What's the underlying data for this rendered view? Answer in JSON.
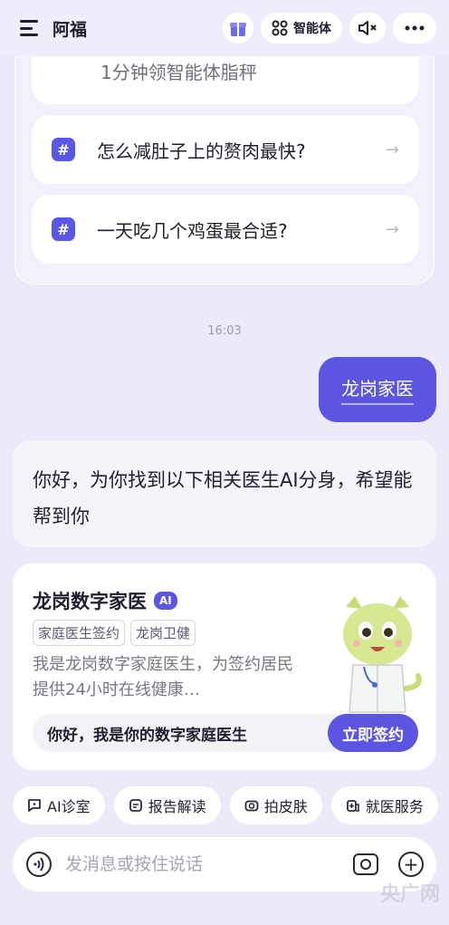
{
  "header": {
    "title": "阿福",
    "agent_label": "智能体"
  },
  "suggestions": {
    "partial_item": "1分钟领智能体脂秤",
    "items": [
      {
        "hash": "#",
        "text": "怎么减肚子上的赘肉最快?",
        "arrow": "→"
      },
      {
        "hash": "#",
        "text": "一天吃几个鸡蛋最合适?",
        "arrow": "→"
      }
    ]
  },
  "chat": {
    "timestamp": "16:03",
    "user_message": "龙岗家医",
    "bot_message": "你好，为你找到以下相关医生AI分身，希望能帮到你"
  },
  "doctor_card": {
    "name": "龙岗数字家医",
    "ai_badge": "AI",
    "tags": [
      "家庭医生签约",
      "龙岗卫健"
    ],
    "description": "我是龙岗数字家庭医生，为签约居民提供24小时在线健康…",
    "greeting": "你好，我是你的数字家庭医生",
    "sign_button": "立即签约"
  },
  "quick_actions": [
    {
      "label": "AI诊室",
      "icon": "chat-icon"
    },
    {
      "label": "报告解读",
      "icon": "report-icon"
    },
    {
      "label": "拍皮肤",
      "icon": "camera-icon"
    },
    {
      "label": "就医服务",
      "icon": "hospital-icon"
    }
  ],
  "input": {
    "placeholder": "发消息或按住说话"
  },
  "watermark": "央广网",
  "colors": {
    "accent": "#5b55e2",
    "background": "#eceaf8"
  }
}
